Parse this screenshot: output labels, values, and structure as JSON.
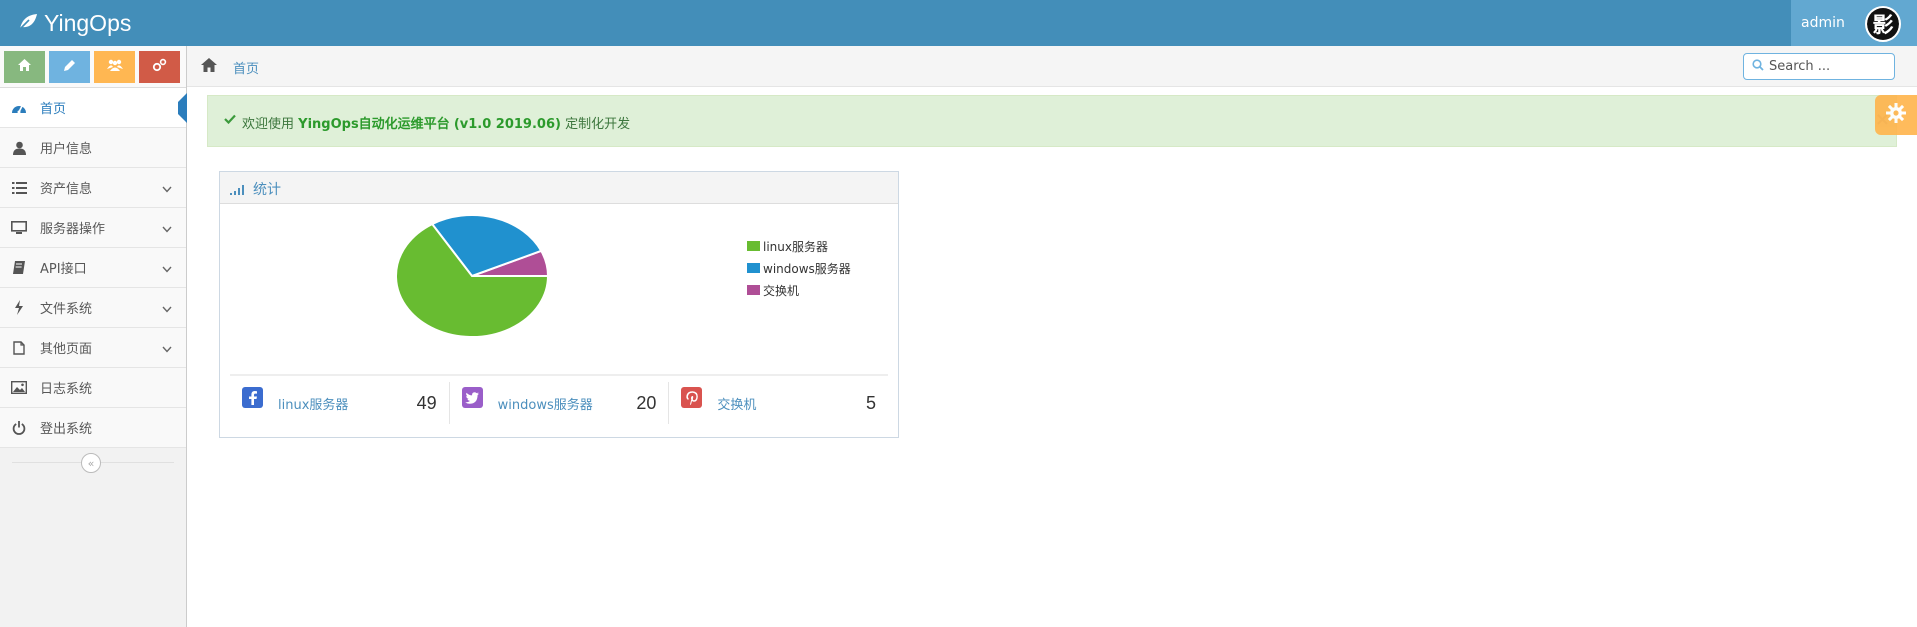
{
  "brand": {
    "name": "YingOps",
    "icon": "leaf-icon"
  },
  "user": {
    "name": "admin",
    "avatar_char": "影"
  },
  "shortcuts": [
    {
      "icon": "home-icon",
      "color": "#87b87f"
    },
    {
      "icon": "pencil-icon",
      "color": "#6fb3e0"
    },
    {
      "icon": "users-icon",
      "color": "#ffb752"
    },
    {
      "icon": "cogs-icon",
      "color": "#d15b47"
    }
  ],
  "sidebar": {
    "items": [
      {
        "label": "首页",
        "icon": "dashboard-icon",
        "active": true,
        "has_sub": false
      },
      {
        "label": "用户信息",
        "icon": "user-icon",
        "active": false,
        "has_sub": false
      },
      {
        "label": "资产信息",
        "icon": "list-icon",
        "active": false,
        "has_sub": true
      },
      {
        "label": "服务器操作",
        "icon": "desktop-icon",
        "active": false,
        "has_sub": true
      },
      {
        "label": "API接口",
        "icon": "book-icon",
        "active": false,
        "has_sub": true
      },
      {
        "label": "文件系统",
        "icon": "bolt-icon",
        "active": false,
        "has_sub": true
      },
      {
        "label": "其他页面",
        "icon": "file-icon",
        "active": false,
        "has_sub": true
      },
      {
        "label": "日志系统",
        "icon": "picture-icon",
        "active": false,
        "has_sub": false
      },
      {
        "label": "登出系统",
        "icon": "power-icon",
        "active": false,
        "has_sub": false
      }
    ],
    "collapse_glyph": "«"
  },
  "breadcrumb": {
    "current": "首页"
  },
  "search": {
    "placeholder": "Search ..."
  },
  "alert": {
    "prefix": "欢迎使用",
    "product": "YingOps自动化运维平台",
    "version": "(v1.0 2019.06)",
    "suffix": "定制化开发",
    "close": "×"
  },
  "widget": {
    "title": "统计"
  },
  "chart_data": {
    "type": "pie",
    "categories": [
      "linux服务器",
      "windows服务器",
      "交换机"
    ],
    "values": [
      49,
      20,
      5
    ],
    "colors": [
      "#68bc31",
      "#2091cf",
      "#af4e96"
    ],
    "legend": "right"
  },
  "stats": [
    {
      "label": "linux服务器",
      "value": "49",
      "icon": "facebook-icon",
      "color": "#3b6ccf"
    },
    {
      "label": "windows服务器",
      "value": "20",
      "icon": "twitter-icon",
      "color": "#9a5ec9"
    },
    {
      "label": "交换机",
      "value": "5",
      "icon": "pinterest-icon",
      "color": "#d9534f"
    }
  ]
}
